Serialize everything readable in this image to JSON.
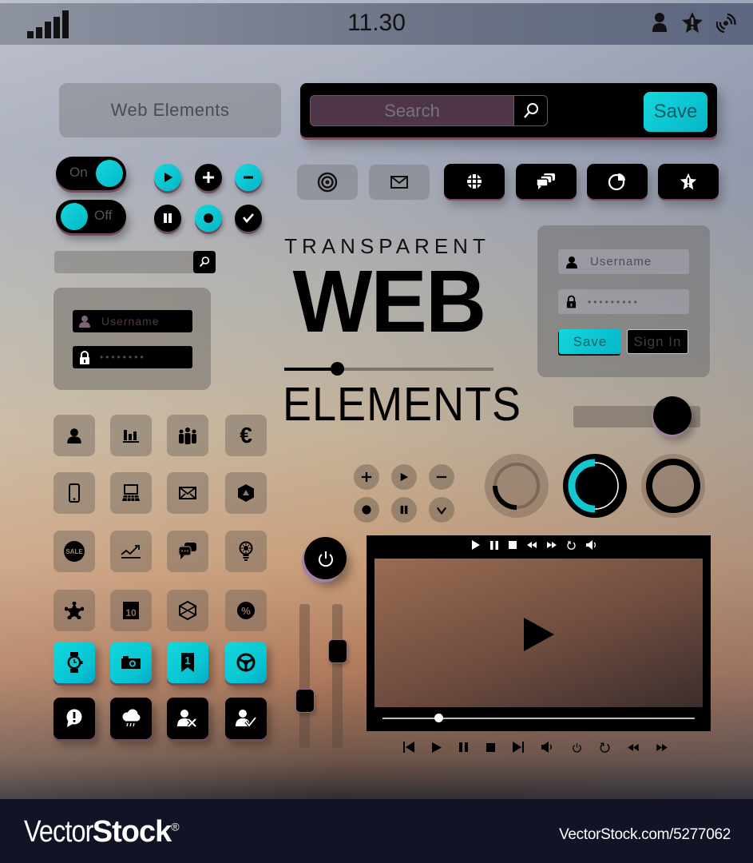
{
  "status_bar": {
    "signal_bars": 5,
    "time": "11.30",
    "icons": [
      "user-icon",
      "star-alert-icon",
      "wireless-signal-icon"
    ]
  },
  "header": {
    "title_box_label": "Web Elements",
    "search": {
      "placeholder": "Search",
      "value": ""
    },
    "save_label": "Save"
  },
  "toggles": [
    {
      "label": "On",
      "state": "on"
    },
    {
      "label": "Off",
      "state": "off"
    }
  ],
  "round_buttons": [
    {
      "icon": "play-icon",
      "style": "cyan"
    },
    {
      "icon": "plus-icon",
      "style": "black"
    },
    {
      "icon": "minus-icon",
      "style": "cyan"
    },
    {
      "icon": "pause-icon",
      "style": "black"
    },
    {
      "icon": "record-icon",
      "style": "cyan"
    },
    {
      "icon": "check-icon",
      "style": "black"
    }
  ],
  "icon_buttons": [
    {
      "icon": "target-icon",
      "style": "gray"
    },
    {
      "icon": "mail-icon",
      "style": "gray"
    },
    {
      "icon": "globe-icon",
      "style": "black"
    },
    {
      "icon": "chat-bubbles-icon",
      "style": "black"
    },
    {
      "icon": "pie-chart-icon",
      "style": "black"
    },
    {
      "icon": "star-alert-icon",
      "style": "black"
    }
  ],
  "mini_search": {
    "value": ""
  },
  "login_left": {
    "username_placeholder": "Username",
    "password_mask": "••••••••"
  },
  "hero": {
    "line1": "TRANSPARENT",
    "line2": "WEB",
    "line3": "ELEMENTS",
    "slider_value": 0.25
  },
  "login_right": {
    "username_placeholder": "Username",
    "password_mask": "•••••••••",
    "save_label": "Save",
    "signin_label": "Sign In"
  },
  "horizontal_slider": {
    "value": 0.78
  },
  "icon_grid": [
    {
      "icon": "user-icon",
      "style": "tan"
    },
    {
      "icon": "bar-chart-icon",
      "style": "tan"
    },
    {
      "icon": "group-icon",
      "style": "tan"
    },
    {
      "icon": "euro-icon",
      "style": "tan",
      "glyph": "€"
    },
    {
      "icon": "smartphone-icon",
      "style": "tan"
    },
    {
      "icon": "laptop-icon",
      "style": "tan"
    },
    {
      "icon": "envelope-icon",
      "style": "tan"
    },
    {
      "icon": "hexagon-triangle-icon",
      "style": "tan"
    },
    {
      "icon": "sale-tag-icon",
      "style": "tan",
      "glyph": "SALE"
    },
    {
      "icon": "trend-line-icon",
      "style": "tan"
    },
    {
      "icon": "chat-icon",
      "style": "tan"
    },
    {
      "icon": "lightbulb-icon",
      "style": "tan"
    },
    {
      "icon": "badge-star-icon",
      "style": "tan"
    },
    {
      "icon": "calendar-icon",
      "style": "tan",
      "glyph": "10"
    },
    {
      "icon": "cube-icon",
      "style": "tan"
    },
    {
      "icon": "percent-icon",
      "style": "tan",
      "glyph": "%"
    },
    {
      "icon": "watch-icon",
      "style": "cyan"
    },
    {
      "icon": "camera-icon",
      "style": "cyan"
    },
    {
      "icon": "bookmark-icon",
      "style": "cyan",
      "glyph": "1"
    },
    {
      "icon": "steering-wheel-icon",
      "style": "cyan"
    },
    {
      "icon": "alert-bubble-icon",
      "style": "black"
    },
    {
      "icon": "rain-cloud-icon",
      "style": "black"
    },
    {
      "icon": "user-remove-icon",
      "style": "black"
    },
    {
      "icon": "user-check-icon",
      "style": "black"
    }
  ],
  "small_media_buttons": [
    "plus-icon",
    "play-icon",
    "minus-icon",
    "record-icon",
    "pause-icon",
    "check-icon"
  ],
  "progress_rings": [
    {
      "value": 0.25,
      "style": "tan"
    },
    {
      "value": 0.5,
      "style": "cyan"
    },
    {
      "value": 1.0,
      "style": "black"
    }
  ],
  "power_button": {
    "icon": "power-icon"
  },
  "vertical_sliders": [
    {
      "value": 0.33
    },
    {
      "value": 0.67
    }
  ],
  "video_player": {
    "top_controls": [
      "play-icon",
      "pause-icon",
      "stop-icon",
      "rewind-icon",
      "fast-forward-icon",
      "replay-icon",
      "volume-icon"
    ],
    "progress": 0.18,
    "bottom_controls": [
      "skip-back-icon",
      "play-icon",
      "pause-icon",
      "stop-icon",
      "skip-forward-icon",
      "volume-icon",
      "power-icon",
      "replay-icon",
      "rewind-icon",
      "fast-forward-icon"
    ]
  },
  "footer": {
    "brand_light": "Vector",
    "brand_bold": "Stock",
    "registered": "®",
    "url": "VectorStock.com/5277062"
  },
  "colors": {
    "accent_cyan": "#14d7dc",
    "search_field": "#4e3548",
    "footer_bg": "#121426"
  }
}
